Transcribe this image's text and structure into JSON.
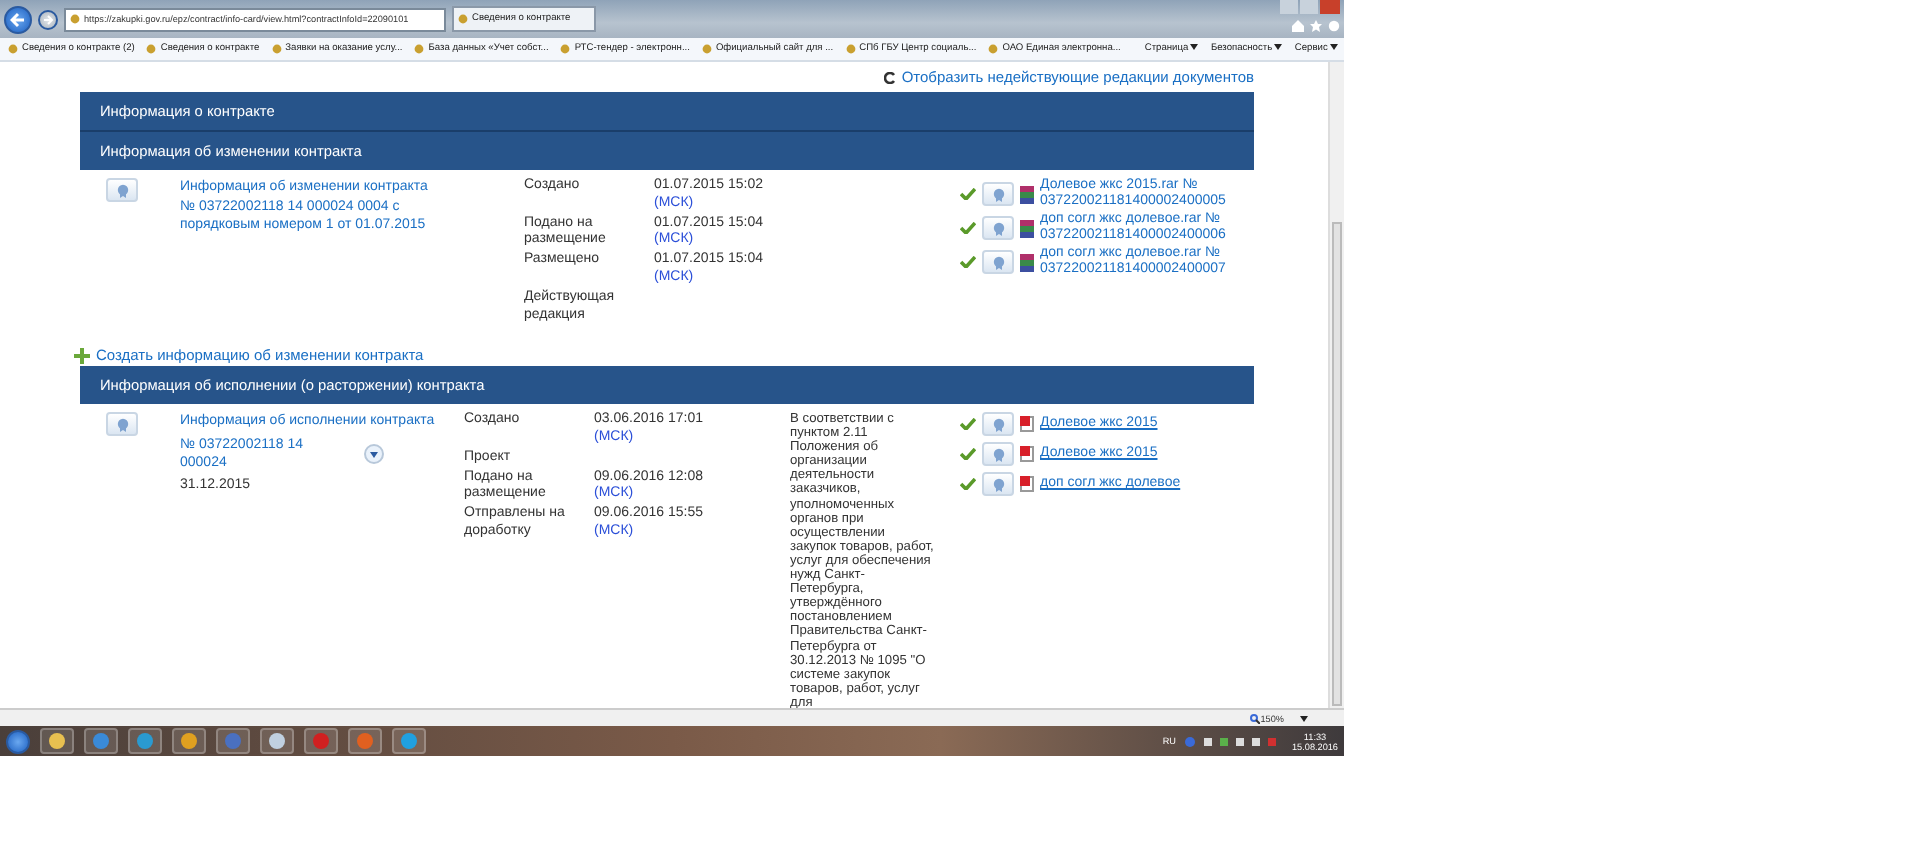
{
  "browser": {
    "address": "https://zakupki.gov.ru/epz/contract/info-card/view.html?contractInfoId=22090101",
    "tab": "Сведения о контракте",
    "favorites": [
      "Сведения о контракте (2)",
      "Сведения о контракте",
      "Заявки на оказание услу...",
      "База данных «Учет собст...",
      "РТС-тендер - электронн...",
      "Официальный сайт для ...",
      "СПб ГБУ Центр социаль...",
      "ОАО Единая электронна..."
    ],
    "commands": [
      "Страница",
      "Безопасность",
      "Сервис"
    ],
    "zoom": "150%"
  },
  "page": {
    "show_inactive_link": "Отобразить недействующие редакции документов",
    "contract_header": "Информация о контракте",
    "changes": {
      "header": "Информация об изменении контракта",
      "document": "Информация об изменении контракта № 03722002118 14 000024 0004 с порядковым номером 1 от 01.07.2015",
      "events": [
        {
          "label": "Создано",
          "date": "01.07.2015 15:02",
          "tz": "(МСК)"
        },
        {
          "label": "Подано на размещение",
          "date": "01.07.2015 15:04",
          "tz": "(МСК)"
        },
        {
          "label": "Размещено",
          "date": "01.07.2015 15:04",
          "tz": "(МСК)"
        },
        {
          "label": "Действующая редакция"
        }
      ],
      "attachments": [
        {
          "kind": "archive",
          "name": "Долевое жкс 2015.rar № 037220021181400002400005"
        },
        {
          "kind": "archive",
          "name": "доп согл жкс долевое.rar № 037220021181400002400006"
        },
        {
          "kind": "archive",
          "name": "доп согл жкс долевое.rar № 037220021181400002400007"
        }
      ]
    },
    "create_link": "Создать информацию об изменении контракта",
    "execution": {
      "header": "Информация об исполнении (о расторжении) контракта",
      "document": "Информация об исполнении контракта",
      "number": "№ 03722002118 14 000024",
      "date": "31.12.2015",
      "events": [
        {
          "label": "Создано",
          "date": "03.06.2016 17:01",
          "tz": "(МСК)"
        },
        {
          "label": "Проект"
        },
        {
          "label": "Подано на размещение",
          "date": "09.06.2016 12:08",
          "tz": "(МСК)"
        },
        {
          "label": "Отправлены на доработку",
          "date": "09.06.2016 15:55",
          "tz": "(МСК)"
        }
      ],
      "note": "В соответствии с пунктом 2.11 Положения об организации деятельности заказчиков, уполномоченных органов при осуществлении закупок товаров, работ, услуг для обеспечения нужд Санкт-Петербурга, утверждённого постановлением Правительства Санкт-Петербурга от 30.12.2013 № 1095 \"О системе закупок товаров, работ, услуг для",
      "attachments": [
        {
          "kind": "pdf",
          "name": "Долевое жкс 2015"
        },
        {
          "kind": "pdf",
          "name": "Долевое жкс 2015"
        },
        {
          "kind": "pdf",
          "name": "доп согл жкс долевое"
        }
      ]
    }
  },
  "taskbar": {
    "language": "RU",
    "time": "11:33",
    "date": "15.08.2016"
  }
}
